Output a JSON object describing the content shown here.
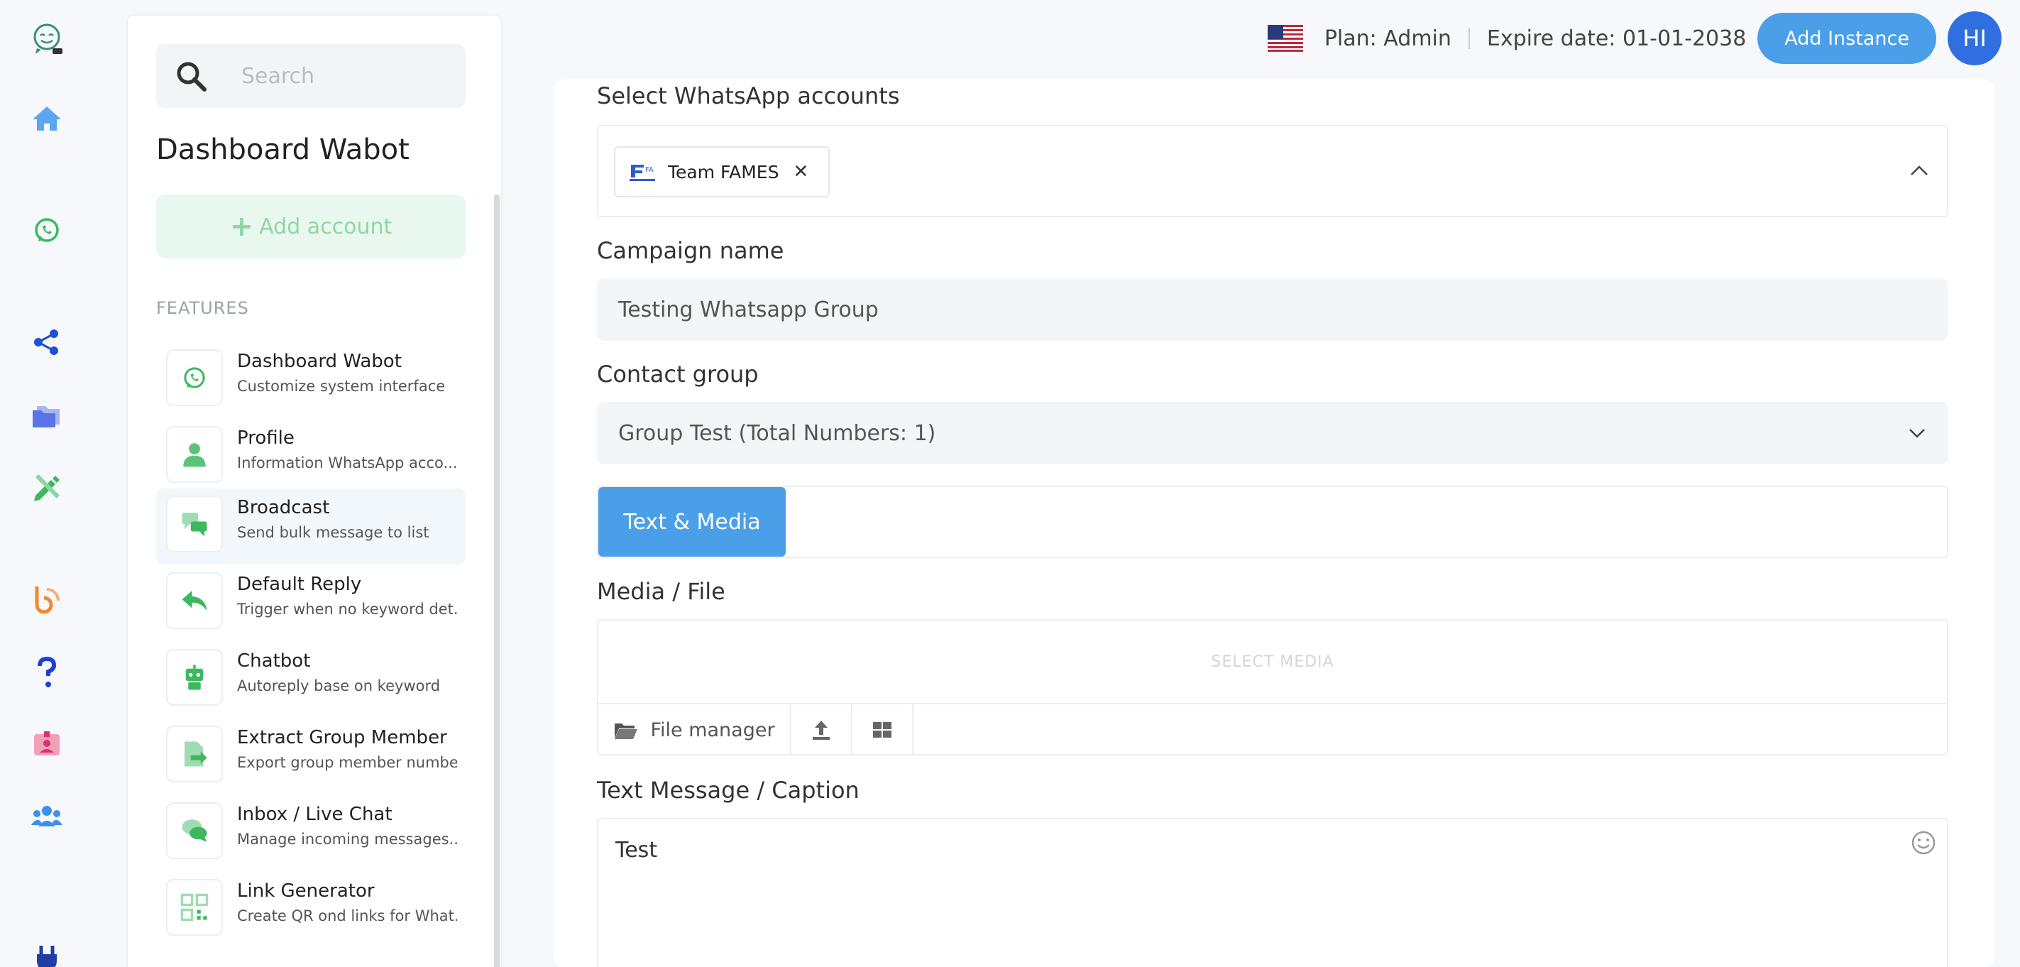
{
  "topbar": {
    "plan": "Plan: Admin",
    "expire": "Expire date: 01-01-2038",
    "add_instance_label": "Add Instance",
    "avatar_initials": "HI",
    "flag_icon": "us-flag-icon"
  },
  "rail": {
    "icons": [
      "app-logo-icon",
      "home-icon",
      "whatsapp-icon",
      "share-icon",
      "folder-icon",
      "pencil-ruler-icon",
      "blog-icon",
      "help-icon",
      "id-badge-icon",
      "users-icon",
      "plug-icon"
    ]
  },
  "sidebar": {
    "search_placeholder": "Search",
    "title": "Dashboard Wabot",
    "add_account_label": "Add account",
    "features_label": "FEATURES",
    "items": [
      {
        "title": "Dashboard Wabot",
        "subtitle": "Customize system interface",
        "icon": "whatsapp-icon"
      },
      {
        "title": "Profile",
        "subtitle": "Information WhatsApp acco...",
        "icon": "user-icon"
      },
      {
        "title": "Broadcast",
        "subtitle": "Send bulk message to list",
        "icon": "chat-bubbles-icon"
      },
      {
        "title": "Default Reply",
        "subtitle": "Trigger when no keyword det...",
        "icon": "reply-icon"
      },
      {
        "title": "Chatbot",
        "subtitle": "Autoreply base on keyword",
        "icon": "robot-icon"
      },
      {
        "title": "Extract Group Member",
        "subtitle": "Export group member number",
        "icon": "file-export-icon"
      },
      {
        "title": "Inbox / Live Chat",
        "subtitle": "Manage incoming messages...",
        "icon": "comments-icon"
      },
      {
        "title": "Link Generator",
        "subtitle": "Create QR ond links for What...",
        "icon": "qrcode-icon"
      }
    ]
  },
  "form": {
    "accounts_label": "Select WhatsApp accounts",
    "selected_account": "Team FAMES",
    "campaign_label": "Campaign name",
    "campaign_value": "Testing Whatsapp Group",
    "contact_group_label": "Contact group",
    "contact_group_value": "Group Test (Total Numbers: 1)",
    "tab_label": "Text & Media",
    "media_label": "Media / File",
    "select_media": "SELECT MEDIA",
    "file_manager_label": "File manager",
    "text_label": "Text Message / Caption",
    "text_value": "Test"
  },
  "colors": {
    "accent": "#4a9fe8",
    "avatar": "#2f6fe0",
    "green": "#3cb95f"
  }
}
